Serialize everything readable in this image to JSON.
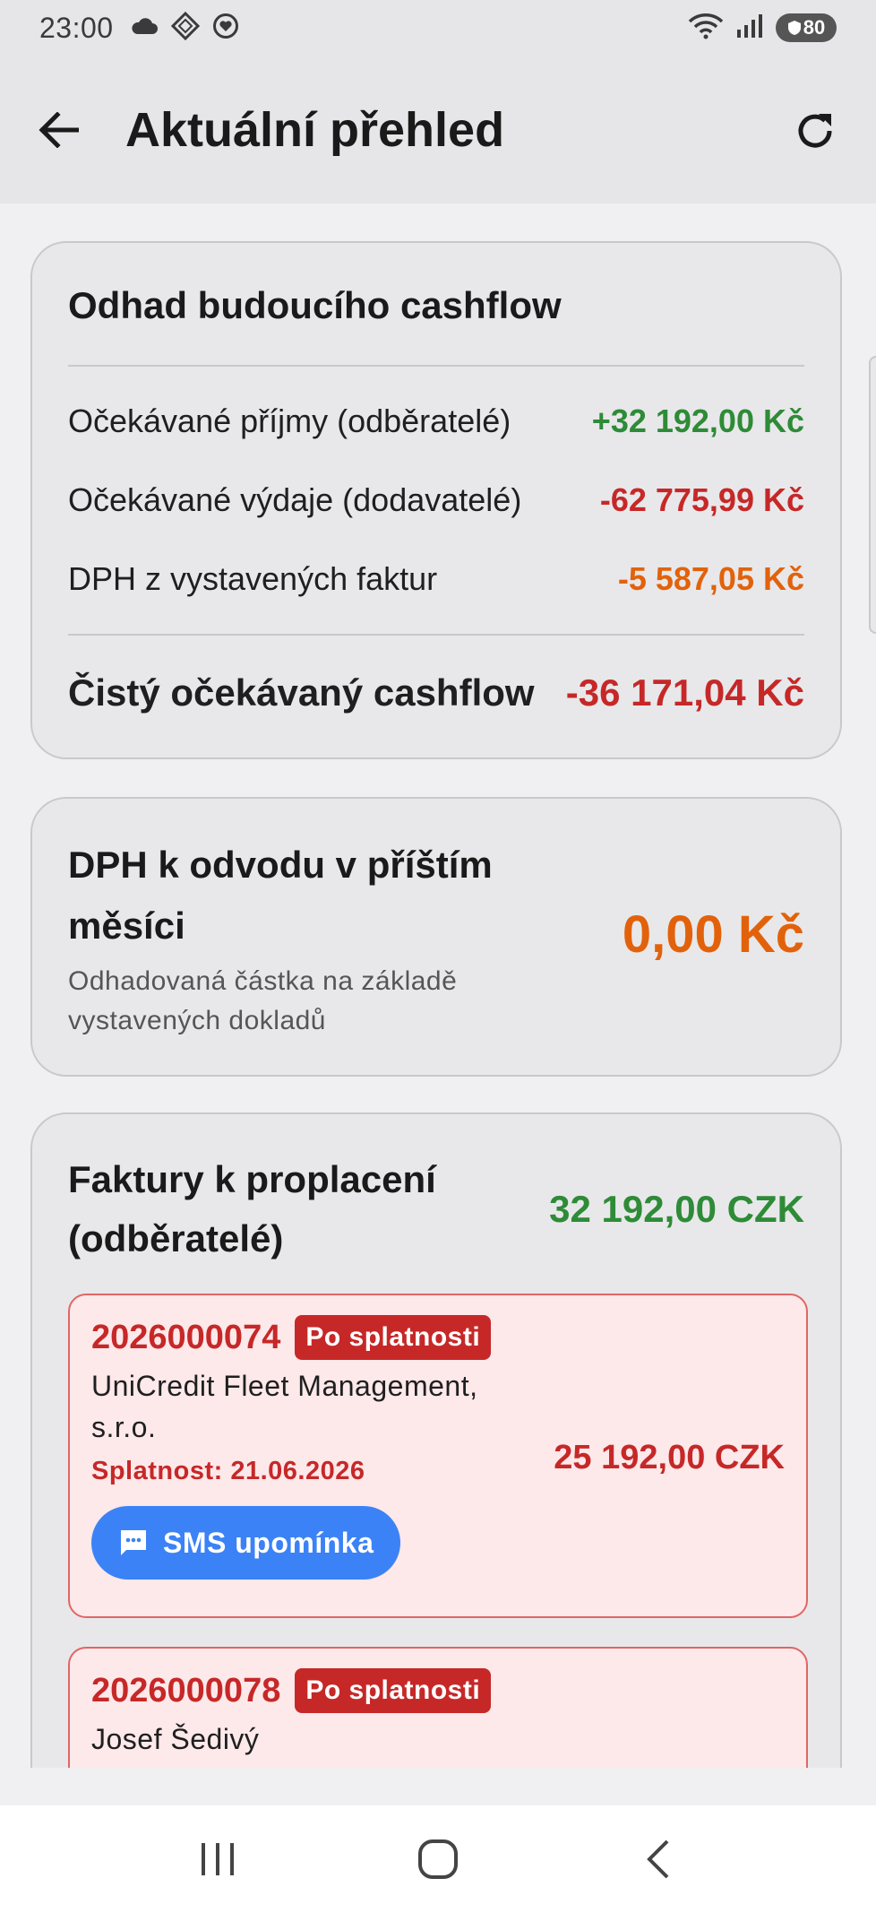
{
  "status_bar": {
    "time": "23:00",
    "battery": "80",
    "icons_left": [
      "cloud-icon",
      "diamond-icon",
      "heart-icon"
    ],
    "icons_right": [
      "wifi-icon",
      "signal-icon",
      "battery-icon"
    ]
  },
  "app_bar": {
    "title": "Aktuální přehled",
    "back_icon": "arrow-left-icon",
    "refresh_icon": "refresh-icon"
  },
  "cashflow": {
    "title": "Odhad budoucího cashflow",
    "rows": [
      {
        "label": "Očekávané příjmy (odběratelé)",
        "value": "+32 192,00 Kč",
        "color": "#2e8b37"
      },
      {
        "label": "Očekávané výdaje (dodavatelé)",
        "value": "-62 775,99 Kč",
        "color": "#c62828"
      },
      {
        "label": "DPH z vystavených faktur",
        "value": "-5 587,05 Kč",
        "color": "#e2620b"
      }
    ],
    "total_label": "Čistý očekávaný cashflow",
    "total_value": "-36 171,04 Kč"
  },
  "vat": {
    "title": "DPH k odvodu v příštím měsíci",
    "subtitle": "Odhadovaná částka na základě vystavených dokladů",
    "amount": "0,00 Kč"
  },
  "receivables": {
    "title": "Faktury k proplacení (odběratelé)",
    "total": "32 192,00 CZK",
    "invoices": [
      {
        "number": "2026000074",
        "badge": "Po splatnosti",
        "client": "UniCredit Fleet Management, s.r.o.",
        "due": "Splatnost: 21.06.2026",
        "amount": "25 192,00 CZK",
        "action": "SMS upomínka"
      },
      {
        "number": "2026000078",
        "badge": "Po splatnosti",
        "client": "Josef Šedivý"
      }
    ]
  },
  "colors": {
    "positive": "#2e8b37",
    "negative": "#c62828",
    "warning": "#e2620b",
    "action": "#3b82f6"
  },
  "nav_bar": {
    "items": [
      "recents-icon",
      "home-icon",
      "back-icon"
    ]
  }
}
